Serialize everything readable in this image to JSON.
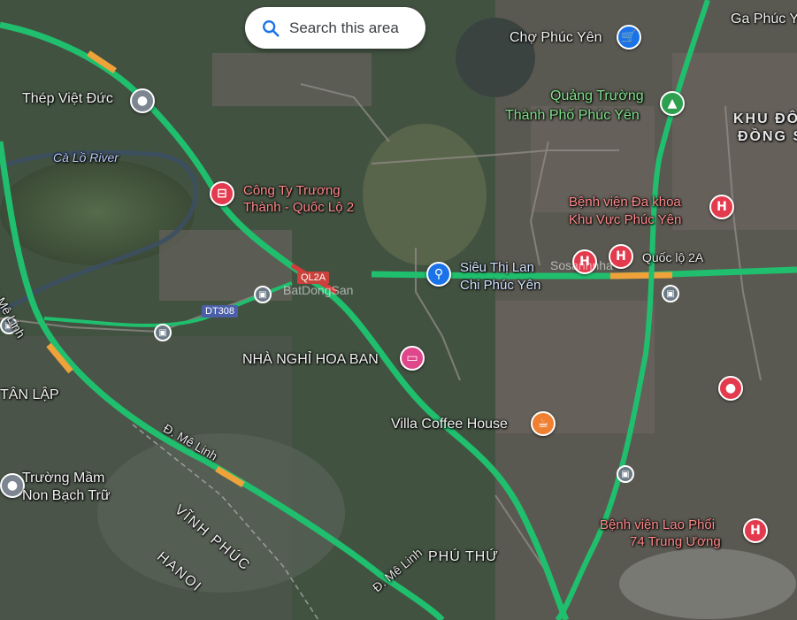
{
  "search": {
    "label": "Search this area"
  },
  "places": {
    "cho_phuc_yen": "Chợ Phúc Yên",
    "ga_phuc_yen": "Ga Phúc Y",
    "thep_viet_duc": "Thép Việt Đức",
    "quang_truong_1": "Quảng Trường",
    "quang_truong_2": "Thành Phố Phúc Yên",
    "khu_do_1": "KHU ĐÔ",
    "khu_do_2": "ĐỒNG S",
    "ca_lo_river": "Cà Lồ River",
    "cong_ty_1": "Công Ty Trương",
    "cong_ty_2": "Thành - Quốc Lộ 2",
    "benh_vien_dk_1": "Bệnh viện Đa khoa",
    "benh_vien_dk_2": "Khu Vực Phúc Yên",
    "quoc_lo_2a": "Quốc lộ 2A",
    "sieu_thi_1": "Siêu Thị Lan",
    "sieu_thi_2": "Chi Phúc Yên",
    "nha_nghi": "NHÀ NGHỈ HOA BAN",
    "tan_lap": "TÂN LẬP",
    "villa_coffee": "Villa Coffee House",
    "truong_mam_1": "Trường Mầm",
    "truong_mam_2": "Non Bạch Trữ",
    "me_linh_1": "Đ. Mê Linh",
    "me_linh_2": "Đ. Mê Linh",
    "me_linh_3": "Đ. Mê Linh",
    "vinh_phuc": "VĨNH PHÚC",
    "hanoi": "HANOI",
    "phu_thu": "PHÚ THỨ",
    "benh_vien_lp_1": "Bệnh viện Lao Phổi",
    "benh_vien_lp_2": "74 Trung Ương"
  },
  "road_shields": {
    "ql2a": "QL2A",
    "dt308": "DT308"
  },
  "watermarks": {
    "batdongsan": "BatDongSan",
    "sosanhnha": "Sosanhnha"
  },
  "colors": {
    "traffic_green": "#1fbf6e",
    "traffic_orange": "#f0a23a",
    "traffic_red": "#d8393a",
    "hospital_red": "#e33a4e"
  }
}
